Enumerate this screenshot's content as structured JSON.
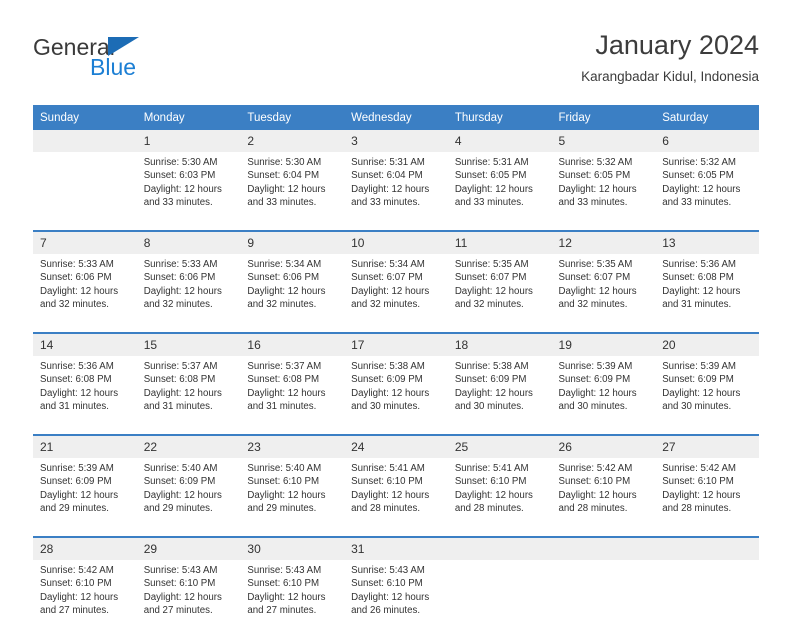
{
  "logo": {
    "word_one": "General",
    "word_two": "Blue",
    "triangle_color": "#1c6cb5",
    "blue_color": "#1c7fd4",
    "dark_color": "#3a3a3a"
  },
  "header": {
    "title": "January 2024",
    "subtitle": "Karangbadar Kidul, Indonesia"
  },
  "theme": {
    "header_blue": "#3b7fc4",
    "daynum_band": "#efefef",
    "text": "#333333"
  },
  "weekdays": [
    "Sunday",
    "Monday",
    "Tuesday",
    "Wednesday",
    "Thursday",
    "Friday",
    "Saturday"
  ],
  "weeks": [
    {
      "days": [
        {
          "num": "",
          "sunrise": "",
          "sunset": "",
          "daylight_a": "",
          "daylight_b": ""
        },
        {
          "num": "1",
          "sunrise": "Sunrise: 5:30 AM",
          "sunset": "Sunset: 6:03 PM",
          "daylight_a": "Daylight: 12 hours",
          "daylight_b": "and 33 minutes."
        },
        {
          "num": "2",
          "sunrise": "Sunrise: 5:30 AM",
          "sunset": "Sunset: 6:04 PM",
          "daylight_a": "Daylight: 12 hours",
          "daylight_b": "and 33 minutes."
        },
        {
          "num": "3",
          "sunrise": "Sunrise: 5:31 AM",
          "sunset": "Sunset: 6:04 PM",
          "daylight_a": "Daylight: 12 hours",
          "daylight_b": "and 33 minutes."
        },
        {
          "num": "4",
          "sunrise": "Sunrise: 5:31 AM",
          "sunset": "Sunset: 6:05 PM",
          "daylight_a": "Daylight: 12 hours",
          "daylight_b": "and 33 minutes."
        },
        {
          "num": "5",
          "sunrise": "Sunrise: 5:32 AM",
          "sunset": "Sunset: 6:05 PM",
          "daylight_a": "Daylight: 12 hours",
          "daylight_b": "and 33 minutes."
        },
        {
          "num": "6",
          "sunrise": "Sunrise: 5:32 AM",
          "sunset": "Sunset: 6:05 PM",
          "daylight_a": "Daylight: 12 hours",
          "daylight_b": "and 33 minutes."
        }
      ]
    },
    {
      "days": [
        {
          "num": "7",
          "sunrise": "Sunrise: 5:33 AM",
          "sunset": "Sunset: 6:06 PM",
          "daylight_a": "Daylight: 12 hours",
          "daylight_b": "and 32 minutes."
        },
        {
          "num": "8",
          "sunrise": "Sunrise: 5:33 AM",
          "sunset": "Sunset: 6:06 PM",
          "daylight_a": "Daylight: 12 hours",
          "daylight_b": "and 32 minutes."
        },
        {
          "num": "9",
          "sunrise": "Sunrise: 5:34 AM",
          "sunset": "Sunset: 6:06 PM",
          "daylight_a": "Daylight: 12 hours",
          "daylight_b": "and 32 minutes."
        },
        {
          "num": "10",
          "sunrise": "Sunrise: 5:34 AM",
          "sunset": "Sunset: 6:07 PM",
          "daylight_a": "Daylight: 12 hours",
          "daylight_b": "and 32 minutes."
        },
        {
          "num": "11",
          "sunrise": "Sunrise: 5:35 AM",
          "sunset": "Sunset: 6:07 PM",
          "daylight_a": "Daylight: 12 hours",
          "daylight_b": "and 32 minutes."
        },
        {
          "num": "12",
          "sunrise": "Sunrise: 5:35 AM",
          "sunset": "Sunset: 6:07 PM",
          "daylight_a": "Daylight: 12 hours",
          "daylight_b": "and 32 minutes."
        },
        {
          "num": "13",
          "sunrise": "Sunrise: 5:36 AM",
          "sunset": "Sunset: 6:08 PM",
          "daylight_a": "Daylight: 12 hours",
          "daylight_b": "and 31 minutes."
        }
      ]
    },
    {
      "days": [
        {
          "num": "14",
          "sunrise": "Sunrise: 5:36 AM",
          "sunset": "Sunset: 6:08 PM",
          "daylight_a": "Daylight: 12 hours",
          "daylight_b": "and 31 minutes."
        },
        {
          "num": "15",
          "sunrise": "Sunrise: 5:37 AM",
          "sunset": "Sunset: 6:08 PM",
          "daylight_a": "Daylight: 12 hours",
          "daylight_b": "and 31 minutes."
        },
        {
          "num": "16",
          "sunrise": "Sunrise: 5:37 AM",
          "sunset": "Sunset: 6:08 PM",
          "daylight_a": "Daylight: 12 hours",
          "daylight_b": "and 31 minutes."
        },
        {
          "num": "17",
          "sunrise": "Sunrise: 5:38 AM",
          "sunset": "Sunset: 6:09 PM",
          "daylight_a": "Daylight: 12 hours",
          "daylight_b": "and 30 minutes."
        },
        {
          "num": "18",
          "sunrise": "Sunrise: 5:38 AM",
          "sunset": "Sunset: 6:09 PM",
          "daylight_a": "Daylight: 12 hours",
          "daylight_b": "and 30 minutes."
        },
        {
          "num": "19",
          "sunrise": "Sunrise: 5:39 AM",
          "sunset": "Sunset: 6:09 PM",
          "daylight_a": "Daylight: 12 hours",
          "daylight_b": "and 30 minutes."
        },
        {
          "num": "20",
          "sunrise": "Sunrise: 5:39 AM",
          "sunset": "Sunset: 6:09 PM",
          "daylight_a": "Daylight: 12 hours",
          "daylight_b": "and 30 minutes."
        }
      ]
    },
    {
      "days": [
        {
          "num": "21",
          "sunrise": "Sunrise: 5:39 AM",
          "sunset": "Sunset: 6:09 PM",
          "daylight_a": "Daylight: 12 hours",
          "daylight_b": "and 29 minutes."
        },
        {
          "num": "22",
          "sunrise": "Sunrise: 5:40 AM",
          "sunset": "Sunset: 6:09 PM",
          "daylight_a": "Daylight: 12 hours",
          "daylight_b": "and 29 minutes."
        },
        {
          "num": "23",
          "sunrise": "Sunrise: 5:40 AM",
          "sunset": "Sunset: 6:10 PM",
          "daylight_a": "Daylight: 12 hours",
          "daylight_b": "and 29 minutes."
        },
        {
          "num": "24",
          "sunrise": "Sunrise: 5:41 AM",
          "sunset": "Sunset: 6:10 PM",
          "daylight_a": "Daylight: 12 hours",
          "daylight_b": "and 28 minutes."
        },
        {
          "num": "25",
          "sunrise": "Sunrise: 5:41 AM",
          "sunset": "Sunset: 6:10 PM",
          "daylight_a": "Daylight: 12 hours",
          "daylight_b": "and 28 minutes."
        },
        {
          "num": "26",
          "sunrise": "Sunrise: 5:42 AM",
          "sunset": "Sunset: 6:10 PM",
          "daylight_a": "Daylight: 12 hours",
          "daylight_b": "and 28 minutes."
        },
        {
          "num": "27",
          "sunrise": "Sunrise: 5:42 AM",
          "sunset": "Sunset: 6:10 PM",
          "daylight_a": "Daylight: 12 hours",
          "daylight_b": "and 28 minutes."
        }
      ]
    },
    {
      "days": [
        {
          "num": "28",
          "sunrise": "Sunrise: 5:42 AM",
          "sunset": "Sunset: 6:10 PM",
          "daylight_a": "Daylight: 12 hours",
          "daylight_b": "and 27 minutes."
        },
        {
          "num": "29",
          "sunrise": "Sunrise: 5:43 AM",
          "sunset": "Sunset: 6:10 PM",
          "daylight_a": "Daylight: 12 hours",
          "daylight_b": "and 27 minutes."
        },
        {
          "num": "30",
          "sunrise": "Sunrise: 5:43 AM",
          "sunset": "Sunset: 6:10 PM",
          "daylight_a": "Daylight: 12 hours",
          "daylight_b": "and 27 minutes."
        },
        {
          "num": "31",
          "sunrise": "Sunrise: 5:43 AM",
          "sunset": "Sunset: 6:10 PM",
          "daylight_a": "Daylight: 12 hours",
          "daylight_b": "and 26 minutes."
        },
        {
          "num": "",
          "sunrise": "",
          "sunset": "",
          "daylight_a": "",
          "daylight_b": ""
        },
        {
          "num": "",
          "sunrise": "",
          "sunset": "",
          "daylight_a": "",
          "daylight_b": ""
        },
        {
          "num": "",
          "sunrise": "",
          "sunset": "",
          "daylight_a": "",
          "daylight_b": ""
        }
      ]
    }
  ]
}
